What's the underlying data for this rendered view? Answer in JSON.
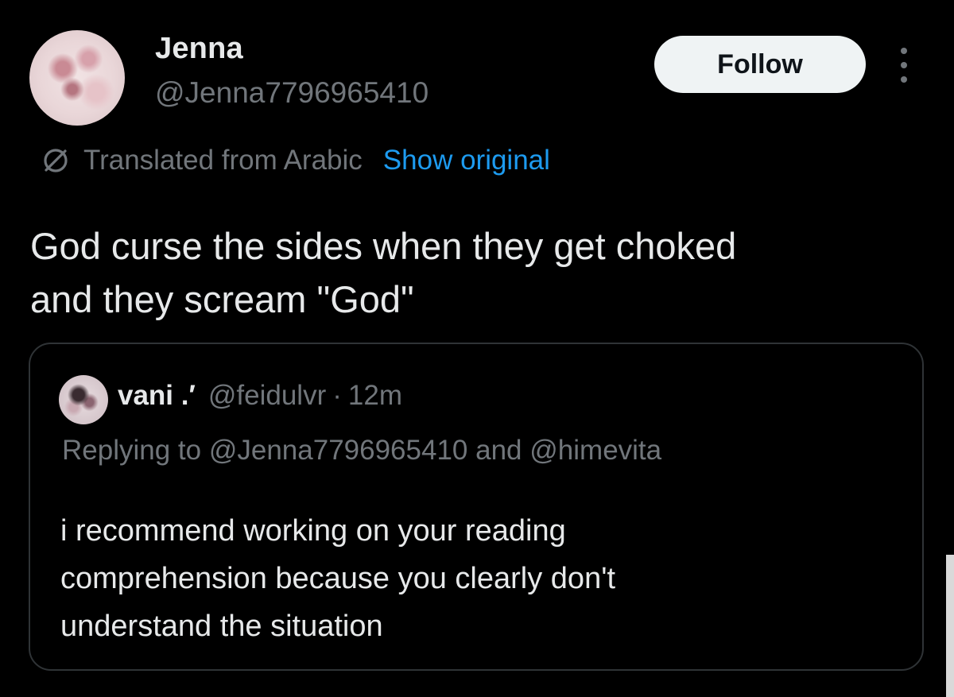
{
  "tweet": {
    "author_name": "Jenna",
    "author_handle": "@Jenna7796965410",
    "follow_label": "Follow",
    "translation": {
      "label": "Translated from Arabic",
      "show_original": "Show original"
    },
    "text": "God curse the sides when they get choked\nand they scream \"God\""
  },
  "quote": {
    "author_name": "vani .′",
    "author_handle": "@feidulvr",
    "separator": "·",
    "time": "12m",
    "replying_prefix": "Replying to",
    "replying_to_1": "@Jenna7796965410",
    "replying_and": "and",
    "replying_to_2": "@himevita",
    "text": "i recommend working on your reading\ncomprehension because you clearly don't\nunderstand the situation"
  },
  "colors": {
    "background": "#000000",
    "primary_text": "#e7e9ea",
    "secondary_text": "#71767b",
    "accent_link": "#1d9bf0",
    "border": "#2f3336",
    "button_bg": "#eff3f4"
  },
  "icons": {
    "translate": "translate-icon",
    "more": "more-options-icon"
  }
}
